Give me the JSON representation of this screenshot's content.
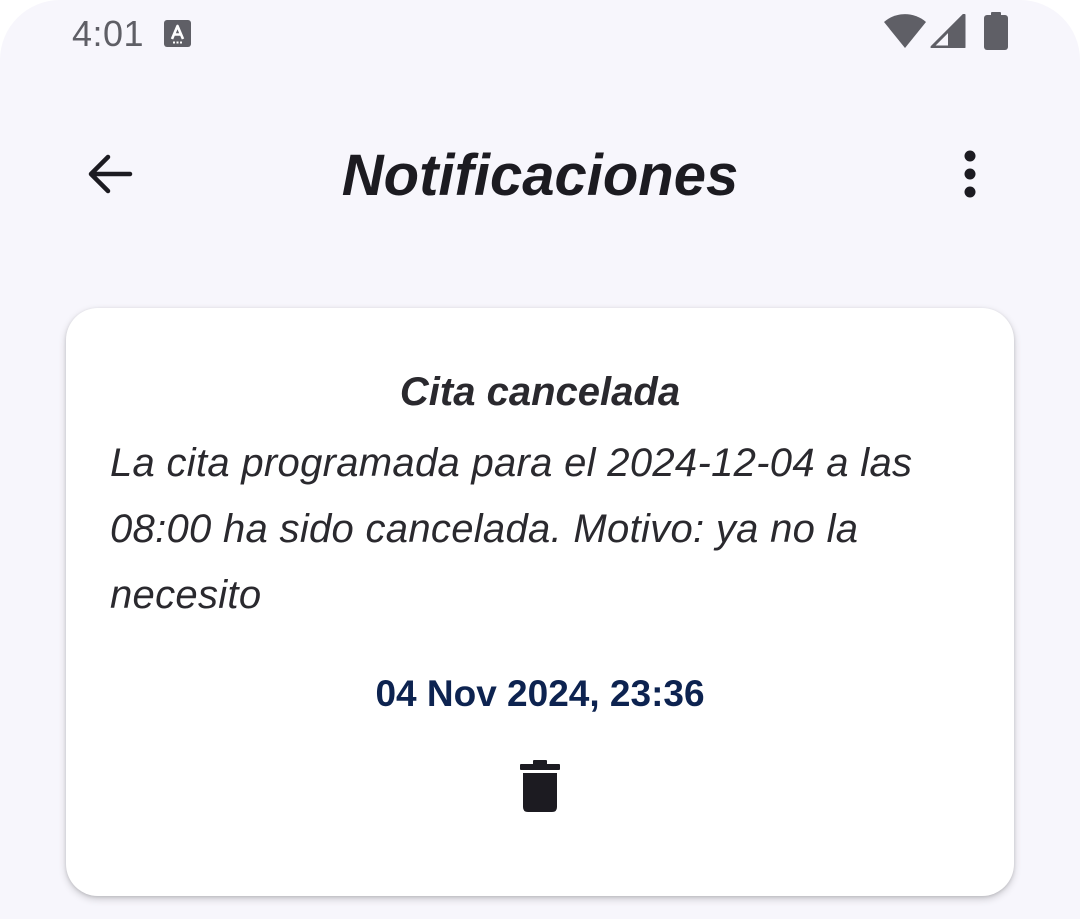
{
  "status_bar": {
    "time": "4:01",
    "notification_icon": "translate-a-icon",
    "icons": [
      "wifi-icon",
      "cellular-signal-icon",
      "battery-icon"
    ]
  },
  "app_bar": {
    "title": "Notificaciones",
    "back_icon": "arrow-back-icon",
    "menu_icon": "more-vert-icon"
  },
  "notifications": [
    {
      "title": "Cita cancelada",
      "message": "La cita programada para el 2024-12-04 a las 08:00 ha sido cancelada. Motivo: ya no la necesito",
      "date": "04 Nov 2024, 23:36",
      "delete_icon": "trash-icon"
    }
  ],
  "colors": {
    "background": "#f7f6fc",
    "card": "#ffffff",
    "text_primary": "#1c1b21",
    "date_text": "#0d2350",
    "status_icons": "#5f5f66"
  }
}
